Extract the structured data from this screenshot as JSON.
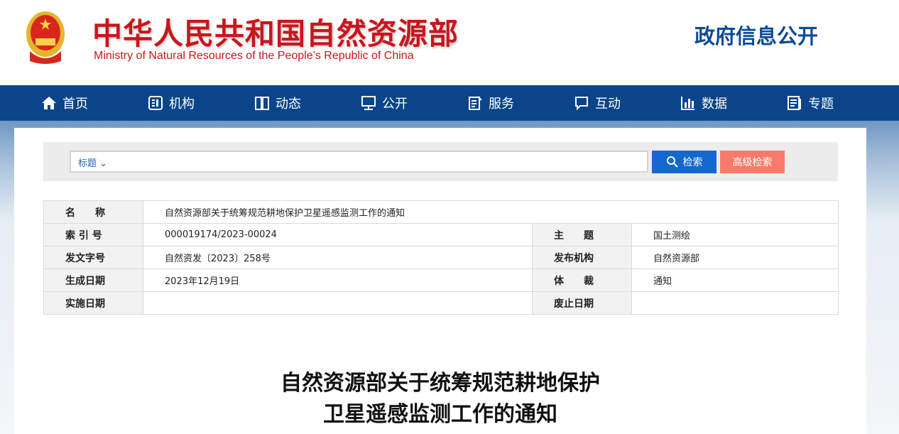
{
  "header": {
    "title_cn": "中华人民共和国自然资源部",
    "title_en": "Ministry of Natural Resources of the People’s Republic of China",
    "gov_info": "政府信息公开"
  },
  "nav": [
    {
      "label": "首页",
      "icon": "home-icon"
    },
    {
      "label": "机构",
      "icon": "org-icon"
    },
    {
      "label": "动态",
      "icon": "book-icon"
    },
    {
      "label": "公开",
      "icon": "monitor-icon"
    },
    {
      "label": "服务",
      "icon": "edit-icon"
    },
    {
      "label": "互动",
      "icon": "chat-icon"
    },
    {
      "label": "数据",
      "icon": "chart-icon"
    },
    {
      "label": "专题",
      "icon": "topic-icon"
    }
  ],
  "search": {
    "scope": "标题",
    "search_label": "检索",
    "advanced_label": "高级检索"
  },
  "info": {
    "name_label": "名　　称",
    "name": "自然资源部关于统筹规范耕地保护卫星遥感监测工作的通知",
    "index_label": "索 引 号",
    "index": "000019174/2023-00024",
    "topic_label": "主　　题",
    "topic": "国土测绘",
    "docno_label": "发文字号",
    "docno": "自然资发〔2023〕258号",
    "issuer_label": "发布机构",
    "issuer": "自然资源部",
    "date_label": "生成日期",
    "date": "2023年12月19日",
    "genre_label": "体　　裁",
    "genre": "通知",
    "effective_label": "实施日期",
    "abolish_label": "废止日期"
  },
  "doc": {
    "title_line1": "自然资源部关于统筹规范耕地保护",
    "title_line2": "卫星遥感监测工作的通知"
  }
}
